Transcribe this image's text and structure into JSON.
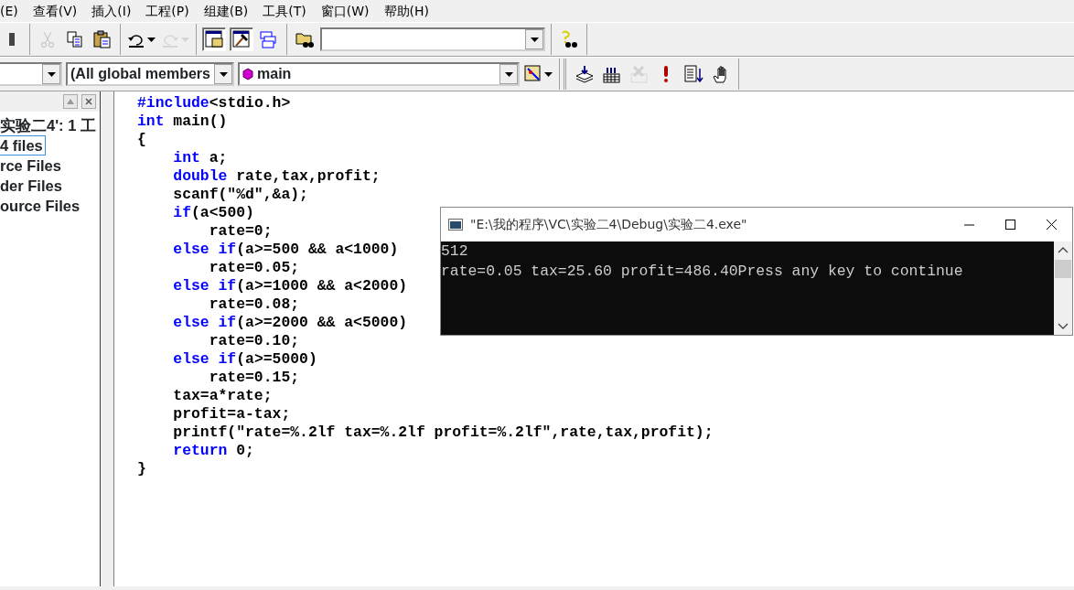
{
  "menu": [
    {
      "label": "(E)"
    },
    {
      "label": "查看(V)"
    },
    {
      "label": "插入(I)"
    },
    {
      "label": "工程(P)"
    },
    {
      "label": "组建(B)"
    },
    {
      "label": "工具(T)"
    },
    {
      "label": "窗口(W)"
    },
    {
      "label": "帮助(H)"
    }
  ],
  "toolbar_1": {
    "groups": [
      [
        {
          "kind": "button",
          "disabled": false,
          "pressed": false
        }
      ],
      [
        {
          "kind": "button",
          "disabled": true,
          "pressed": false
        },
        {
          "kind": "button",
          "disabled": false,
          "pressed": false
        },
        {
          "kind": "button",
          "disabled": false,
          "pressed": false
        }
      ],
      [
        {
          "kind": "split",
          "disabled": false,
          "pressed": false
        },
        {
          "kind": "split",
          "disabled": true,
          "pressed": false
        }
      ],
      [
        {
          "kind": "button",
          "disabled": false,
          "pressed": true
        },
        {
          "kind": "button",
          "disabled": false,
          "pressed": true
        },
        {
          "kind": "button",
          "disabled": false,
          "pressed": false
        }
      ],
      [
        {
          "kind": "button",
          "disabled": false,
          "pressed": false
        },
        {
          "kind": "combo"
        }
      ],
      [
        {
          "kind": "button",
          "disabled": false,
          "pressed": false
        }
      ]
    ]
  },
  "toolbar_2": {
    "combos": [
      {
        "kind": "class"
      },
      {
        "kind": "members",
        "value": "(All global members"
      },
      {
        "kind": "function",
        "value": "main"
      }
    ],
    "buttons": [
      {
        "kind": "split",
        "disabled": false
      },
      {
        "kind": "button",
        "disabled": false
      },
      {
        "kind": "button",
        "disabled": false
      },
      {
        "kind": "button",
        "disabled": true
      },
      {
        "kind": "button",
        "disabled": false
      },
      {
        "kind": "button",
        "disabled": false
      },
      {
        "kind": "button",
        "disabled": false
      }
    ]
  },
  "workspace": {
    "items": [
      {
        "label": "实验二4': 1 工",
        "selected": false
      },
      {
        "label": "4 files",
        "selected": true
      },
      {
        "label": "rce Files",
        "selected": false
      },
      {
        "label": "der Files",
        "selected": false
      },
      {
        "label": "ource Files",
        "selected": false
      }
    ]
  },
  "editor": {
    "lines": [
      [
        {
          "kind": "keyword",
          "text": "#include"
        },
        {
          "kind": "plain",
          "text": "<stdio.h>"
        }
      ],
      [
        {
          "kind": "keyword",
          "text": "int"
        },
        {
          "kind": "plain",
          "text": " main()"
        }
      ],
      [
        {
          "kind": "plain",
          "text": "{"
        }
      ],
      [
        {
          "kind": "keyword",
          "text": "    int"
        },
        {
          "kind": "plain",
          "text": " a;"
        }
      ],
      [
        {
          "kind": "keyword",
          "text": "    double"
        },
        {
          "kind": "plain",
          "text": " rate,tax,profit;"
        }
      ],
      [
        {
          "kind": "plain",
          "text": "    scanf(\"%d\",&a);"
        }
      ],
      [
        {
          "kind": "keyword",
          "text": "    if"
        },
        {
          "kind": "plain",
          "text": "(a<500)"
        }
      ],
      [
        {
          "kind": "plain",
          "text": "        rate=0;"
        }
      ],
      [
        {
          "kind": "keyword",
          "text": "    else if"
        },
        {
          "kind": "plain",
          "text": "(a>=500 && a<1000)"
        }
      ],
      [
        {
          "kind": "plain",
          "text": "        rate=0.05;"
        }
      ],
      [
        {
          "kind": "keyword",
          "text": "    else if"
        },
        {
          "kind": "plain",
          "text": "(a>=1000 && a<2000)"
        }
      ],
      [
        {
          "kind": "plain",
          "text": "        rate=0.08;"
        }
      ],
      [
        {
          "kind": "keyword",
          "text": "    else if"
        },
        {
          "kind": "plain",
          "text": "(a>=2000 && a<5000)"
        }
      ],
      [
        {
          "kind": "plain",
          "text": "        rate=0.10;"
        }
      ],
      [
        {
          "kind": "keyword",
          "text": "    else if"
        },
        {
          "kind": "plain",
          "text": "(a>=5000)"
        }
      ],
      [
        {
          "kind": "plain",
          "text": "        rate=0.15;"
        }
      ],
      [
        {
          "kind": "plain",
          "text": "    tax=a*rate;"
        }
      ],
      [
        {
          "kind": "plain",
          "text": "    profit=a-tax;"
        }
      ],
      [
        {
          "kind": "plain",
          "text": "    printf(\"rate=%.2lf tax=%.2lf profit=%.2lf\",rate,tax,profit);"
        }
      ],
      [
        {
          "kind": "keyword",
          "text": "    return"
        },
        {
          "kind": "plain",
          "text": " 0;"
        }
      ],
      [
        {
          "kind": "plain",
          "text": "}"
        }
      ]
    ]
  },
  "console": {
    "title": "\"E:\\我的程序\\VC\\实验二4\\Debug\\实验二4.exe\"",
    "lines": [
      "512",
      "rate=0.05 tax=25.60 profit=486.40Press any key to continue"
    ]
  }
}
